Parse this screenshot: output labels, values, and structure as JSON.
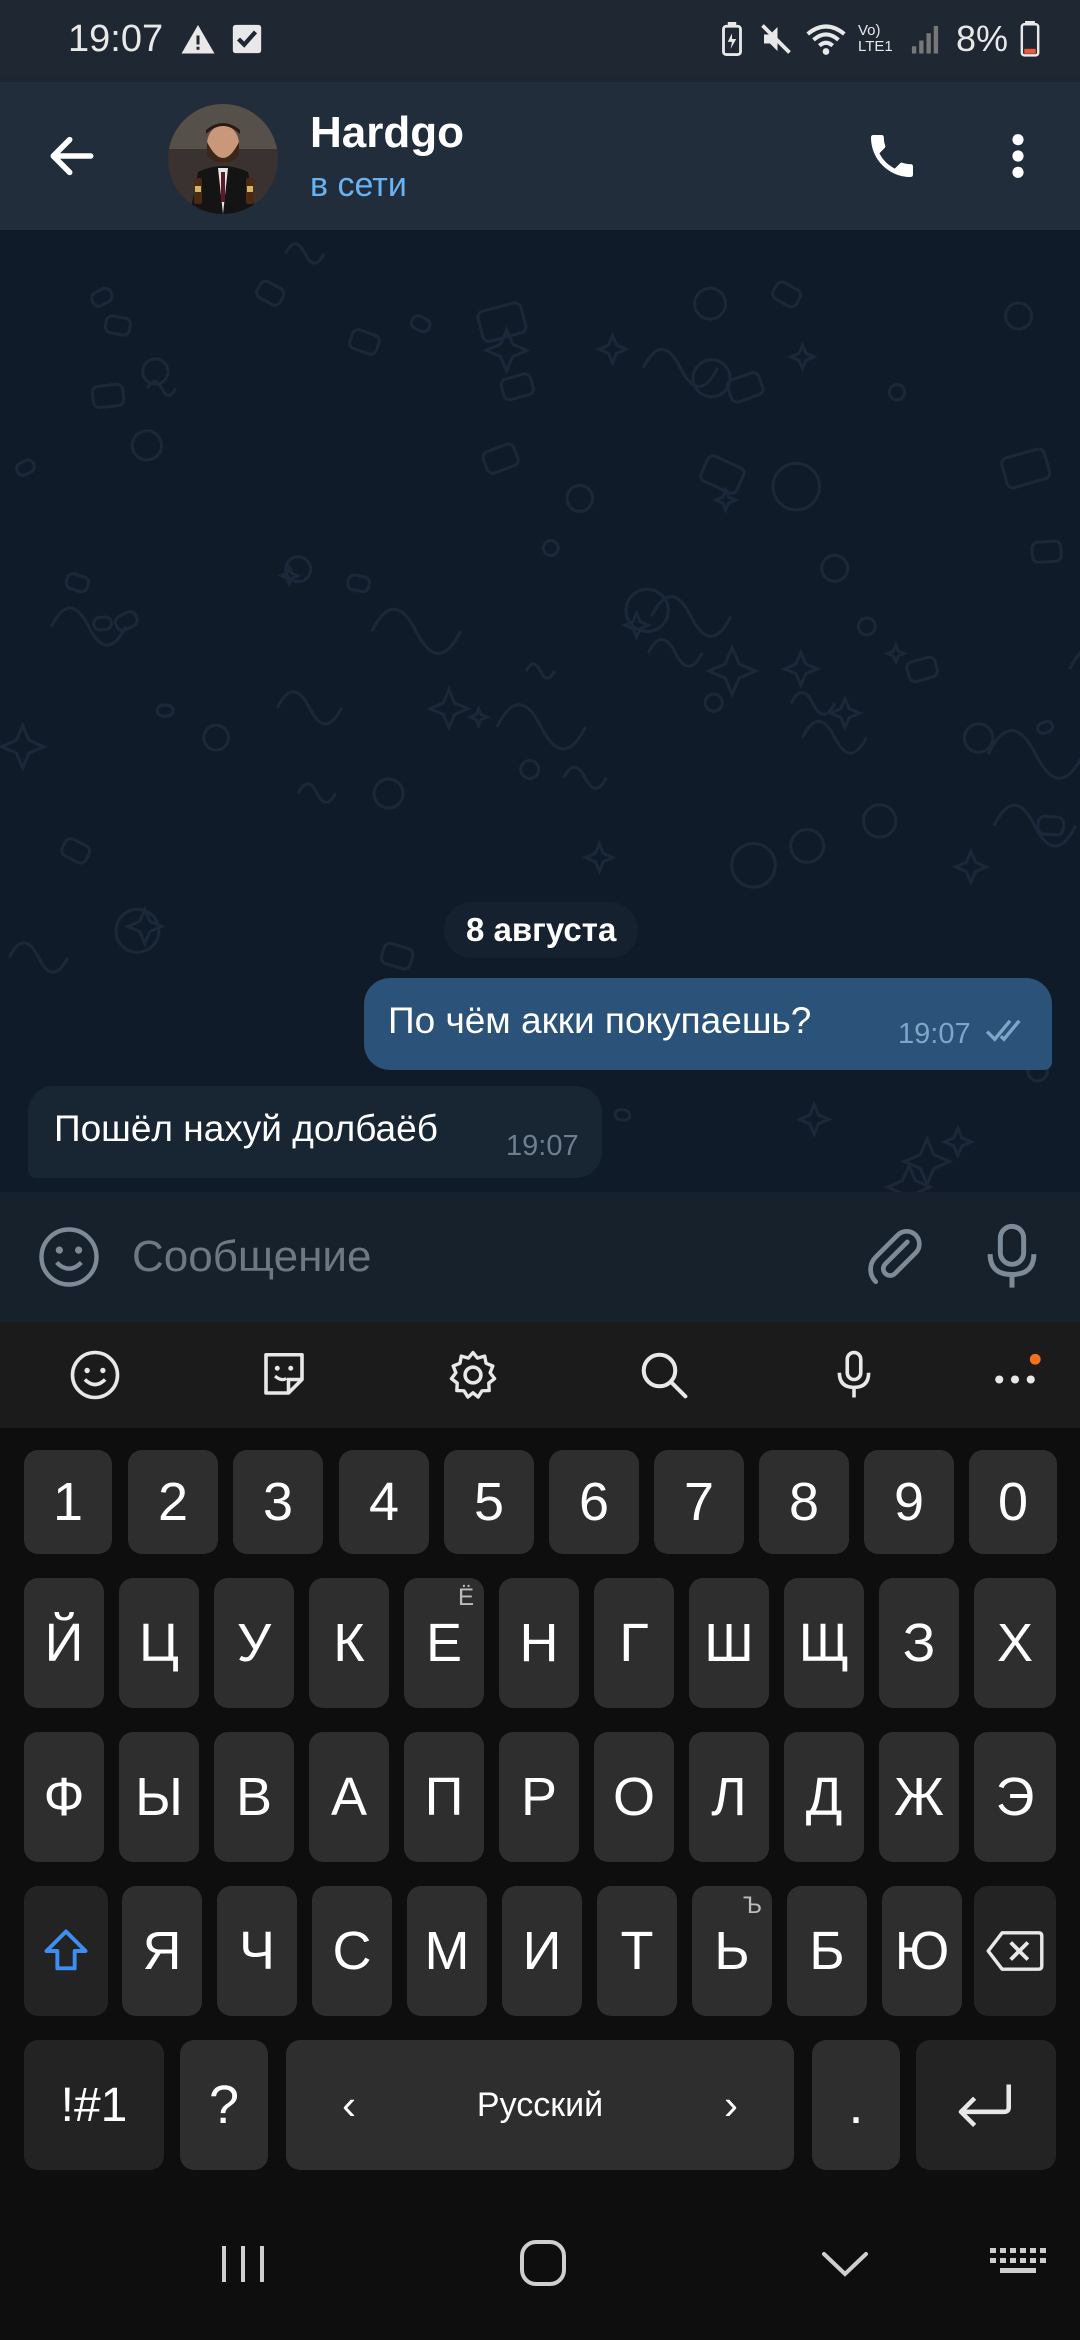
{
  "status_bar": {
    "time": "19:07",
    "battery": "8%",
    "network": "Vo) LTE1"
  },
  "header": {
    "back_icon": "arrow-left-icon",
    "contact_name": "Hardgo",
    "contact_status": "в сети",
    "call_icon": "phone-icon",
    "menu_icon": "more-vert-icon"
  },
  "chat": {
    "date_label": "8 августа",
    "messages": [
      {
        "direction": "outgoing",
        "text": "По чём акки покупаешь?",
        "time": "19:07",
        "status": "read"
      },
      {
        "direction": "incoming",
        "text": "Пошёл нахуй долбаёб",
        "time": "19:07"
      }
    ]
  },
  "input_bar": {
    "placeholder": "Сообщение",
    "emoji_icon": "smiley-icon",
    "attach_icon": "paperclip-icon",
    "mic_icon": "microphone-icon"
  },
  "keyboard": {
    "toolbar": [
      "emoji-icon",
      "sticker-icon",
      "settings-icon",
      "search-icon",
      "voice-icon",
      "more-icon"
    ],
    "rows": [
      [
        "1",
        "2",
        "3",
        "4",
        "5",
        "6",
        "7",
        "8",
        "9",
        "0"
      ],
      [
        "Й",
        "Ц",
        "У",
        "К",
        "Е",
        "Н",
        "Г",
        "Ш",
        "Щ",
        "З",
        "Х"
      ],
      [
        "Ф",
        "Ы",
        "В",
        "А",
        "П",
        "Р",
        "О",
        "Л",
        "Д",
        "Ж",
        "Э"
      ],
      [
        "Я",
        "Ч",
        "С",
        "М",
        "И",
        "Т",
        "Ь",
        "Б",
        "Ю"
      ]
    ],
    "hints": {
      "Е": "Ё",
      "Ь": "Ъ"
    },
    "symbols_key": "!#1",
    "question_key": "?",
    "language": "Русский",
    "period_key": ".",
    "shift_icon": "shift-icon",
    "backspace_icon": "backspace-icon",
    "enter_icon": "enter-icon"
  },
  "nav_bar": [
    "recents-icon",
    "home-icon",
    "back-icon",
    "keyboard-icon"
  ],
  "colors": {
    "accent": "#6ab3f3",
    "outgoing_bubble": "#2b5278",
    "incoming_bubble": "#182533",
    "header": "#212d3b"
  }
}
